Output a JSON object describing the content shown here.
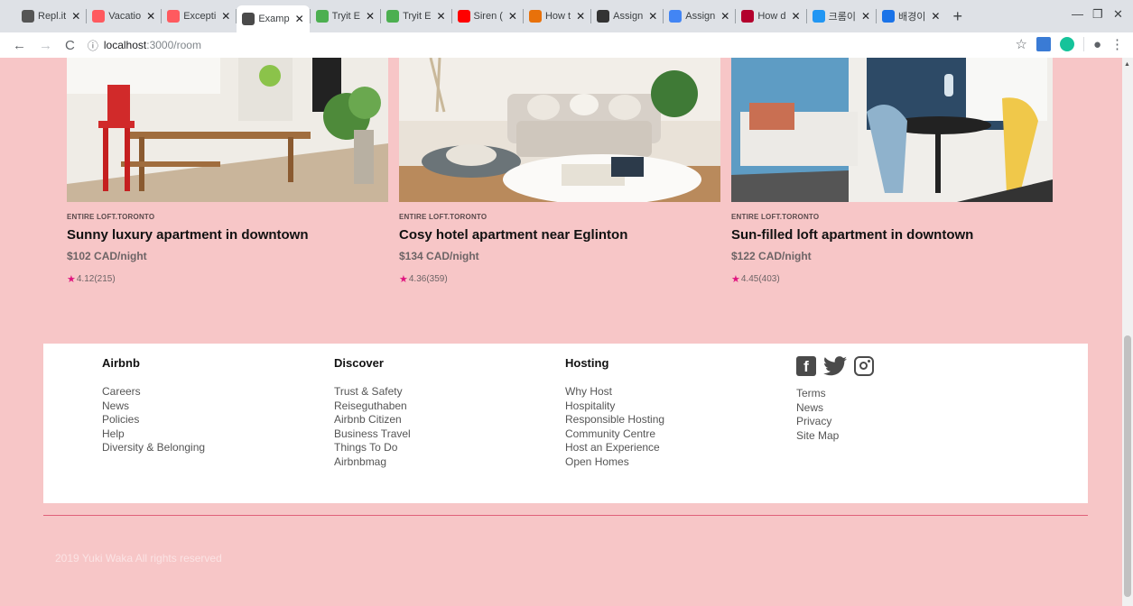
{
  "browser": {
    "tabs": [
      {
        "label": "Repl.it",
        "color": "#555555"
      },
      {
        "label": "Vacatio",
        "color": "#ff5a5f"
      },
      {
        "label": "Excepti",
        "color": "#ff5a5f"
      },
      {
        "label": "Examp",
        "color": "#4a4a4a",
        "active": true
      },
      {
        "label": "Tryit E",
        "color": "#4caf50"
      },
      {
        "label": "Tryit E",
        "color": "#4caf50"
      },
      {
        "label": "Siren (",
        "color": "#ff0000"
      },
      {
        "label": "How t",
        "color": "#e8710a"
      },
      {
        "label": "Assign",
        "color": "#333333"
      },
      {
        "label": "Assign",
        "color": "#4285f4"
      },
      {
        "label": "How d",
        "color": "#b3002d"
      },
      {
        "label": "크롬이",
        "color": "#2196f3"
      },
      {
        "label": "배경이",
        "color": "#1a73e8"
      }
    ],
    "url_host": "localhost",
    "url_path": ":3000/room"
  },
  "listings": [
    {
      "kind": "ENTIRE LOFT.TORONTO",
      "title": "Sunny luxury apartment in downtown",
      "price": "$102 CAD/night",
      "rating": "4.12",
      "reviews": "(215)"
    },
    {
      "kind": "ENTIRE LOFT.TORONTO",
      "title": "Cosy hotel apartment near Eglinton",
      "price": "$134 CAD/night",
      "rating": "4.36",
      "reviews": "(359)"
    },
    {
      "kind": "ENTIRE LOFT.TORONTO",
      "title": "Sun-filled loft apartment in downtown",
      "price": "$122 CAD/night",
      "rating": "4.45",
      "reviews": "(403)"
    }
  ],
  "footer": {
    "columns": [
      {
        "heading": "Airbnb",
        "links": [
          "Careers",
          "News",
          "Policies",
          "Help",
          "Diversity & Belonging"
        ]
      },
      {
        "heading": "Discover",
        "links": [
          "Trust & Safety",
          "Reiseguthaben",
          "Airbnb Citizen",
          "Business Travel",
          "Things To Do",
          "Airbnbmag"
        ]
      },
      {
        "heading": "Hosting",
        "links": [
          "Why Host",
          "Hospitality",
          "Responsible Hosting",
          "Community Centre",
          "Host an Experience",
          "Open Homes"
        ]
      }
    ],
    "social": [
      "facebook-icon",
      "twitter-icon",
      "instagram-icon"
    ],
    "social_fb_letter": "f",
    "legal_links": [
      "Terms",
      "News",
      "Privacy",
      "Site Map"
    ],
    "copyright": "2019 Yuki Waka All rights reserved"
  },
  "colors": {
    "page_bg": "#f7c6c7",
    "star": "#e0157f",
    "footer_line": "#e0607a"
  }
}
